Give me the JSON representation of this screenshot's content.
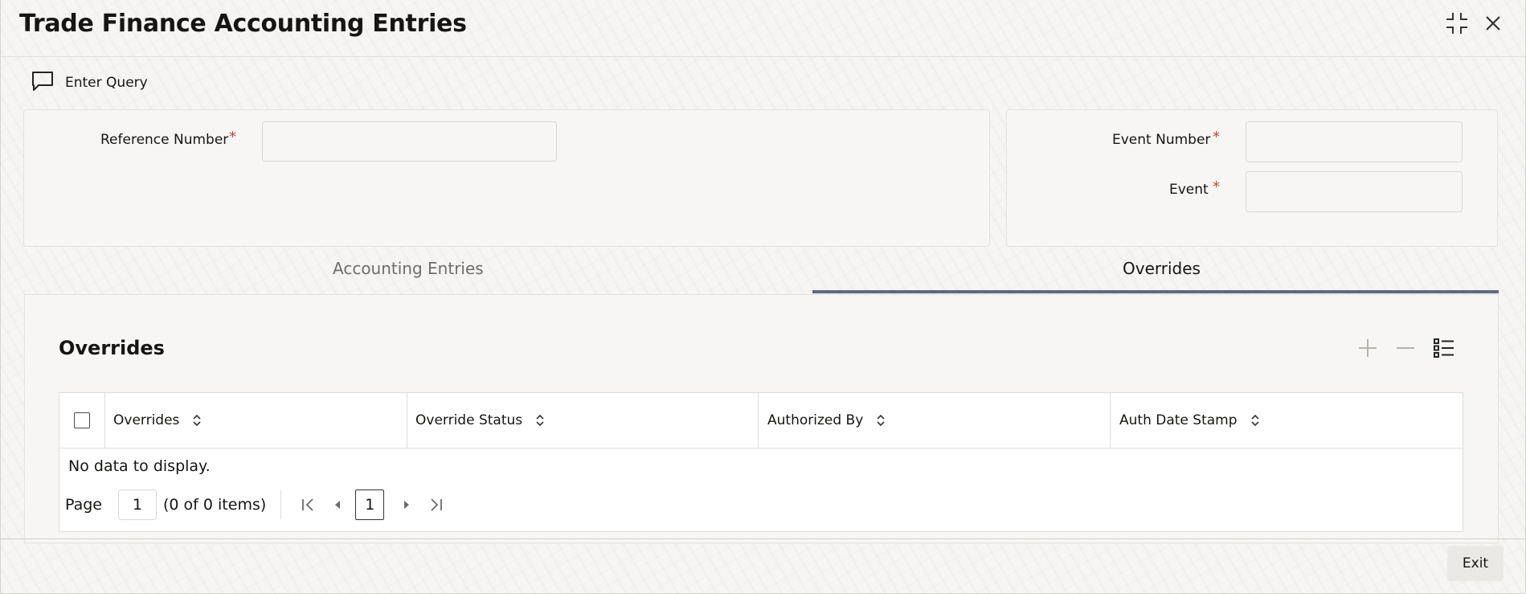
{
  "window": {
    "title": "Trade Finance Accounting Entries"
  },
  "toolbar": {
    "enter_query_label": "Enter Query"
  },
  "form": {
    "reference_number": {
      "label": "Reference Number",
      "required": "*",
      "value": ""
    },
    "event_number": {
      "label": "Event Number",
      "required": "*",
      "value": ""
    },
    "event": {
      "label": "Event",
      "required": "*",
      "value": ""
    }
  },
  "tabs": [
    {
      "label": "Accounting Entries",
      "selected": false
    },
    {
      "label": "Overrides",
      "selected": true
    }
  ],
  "overrides_section": {
    "title": "Overrides",
    "columns": [
      "Overrides",
      "Override Status",
      "Authorized By",
      "Auth Date Stamp"
    ],
    "empty_message": "No data to display.",
    "pager": {
      "page_label": "Page",
      "page_input": "1",
      "items_summary": "(0 of 0 items)",
      "current_page": "1"
    }
  },
  "footer": {
    "exit_label": "Exit"
  },
  "colors": {
    "required": "#c74634",
    "tab_underline": "#5e6a7f",
    "background": "#f6f5f3"
  }
}
